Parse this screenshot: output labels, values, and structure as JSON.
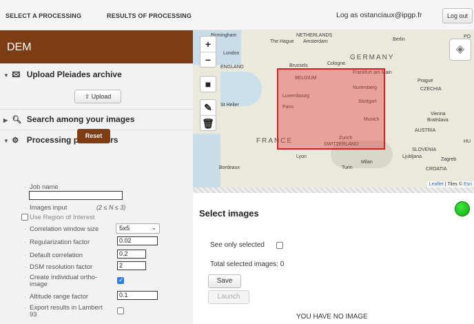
{
  "topbar": {
    "select_processing": "SELECT A PROCESSING",
    "results_processing": "RESULTS OF PROCESSING",
    "user_label": "Log as ostanciaux@ipgp.fr",
    "logout_label": "Log out"
  },
  "sidebar": {
    "title": "DEM",
    "upload_section": "Upload Pleiades archive",
    "upload_button": "Upload",
    "search_section": "Search among your images",
    "processing_section": "Processing parameters",
    "reset_button": "Reset"
  },
  "form": {
    "job_name_label": "Job name",
    "job_name_value": "",
    "images_input_label": "Images input",
    "images_input_hint": "(2 ≤ N ≤ 3)",
    "roi_label": "Use Region of Interest",
    "roi_checked": false,
    "correlation_label": "Correlation window size",
    "correlation_value": "5x5",
    "regularization_label": "Regularization factor",
    "regularization_value": "0.02",
    "default_corr_label": "Default correlation",
    "default_corr_value": "0.2",
    "dsm_label": "DSM resolution factor",
    "dsm_value": "2",
    "ortho_label_1": "Create individual ortho-",
    "ortho_label_2": "image",
    "ortho_checked": true,
    "altitude_label": "Altitude range factor",
    "altitude_value": "0.1",
    "lambert_label_1": "Export results in Lambert",
    "lambert_label_2": "93",
    "lambert_checked": false
  },
  "map": {
    "country_germany": "GERMANY",
    "country_france": "FRANCE",
    "cities": {
      "birmingham": "Birmingham",
      "netherlands": "NETHERLANDS",
      "the_hague": "The Hague",
      "amsterdam": "Amsterdam",
      "berlin": "Berlin",
      "po": "PO",
      "london": "London",
      "england": "ENGLAND",
      "brussels": "Brussels",
      "cologne": "Cologne",
      "belgium": "BELGIUM",
      "frankfurt": "Frankfurt am Main",
      "prague": "Prague",
      "czechia": "CZECHIA",
      "luxembourg": "Luxembourg",
      "nuremberg": "Nuremberg",
      "st_helier": "St Helier",
      "paris": "Paris",
      "stuttgart": "Stuttgart",
      "vienna": "Vienna",
      "bratislava": "Bratislava",
      "munich": "Munich",
      "austria": "AUSTRIA",
      "zurich": "Zurich",
      "switzerland": "SWITZERLAND",
      "hu": "HU",
      "lyon": "Lyon",
      "slovenia": "SLOVENIA",
      "ljubljana": "Ljubljana",
      "zagreb": "Zagreb",
      "bordeaux": "Bordeaux",
      "milan": "Milan",
      "turin": "Turin",
      "croatia": "CROATIA"
    },
    "attribution_leaflet": "Leaflet",
    "attribution_tiles": "| Tiles ©",
    "attribution_esri": "Esri"
  },
  "panel": {
    "title": "Select images",
    "see_only_selected": "See only selected",
    "total_selected": "Total selected images: 0",
    "save_button": "Save",
    "launch_button": "Launch",
    "no_image": "YOU HAVE NO IMAGE",
    "status_color": "#14b814"
  }
}
